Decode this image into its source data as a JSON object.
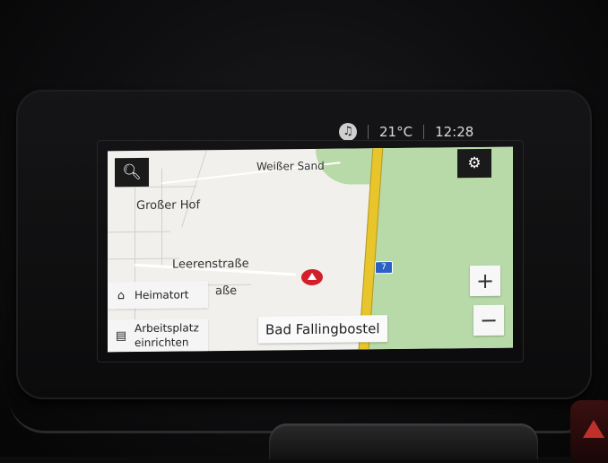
{
  "status_bar": {
    "music_icon": "music-note-icon",
    "temperature": "21°C",
    "clock": "12:28"
  },
  "map": {
    "labels": {
      "weisser_sand": "Weißer Sand",
      "grosser_hof": "Großer Hof",
      "leerenstrasse": "Leerenstraße",
      "partial_street": "aße"
    },
    "highway_number": "7",
    "colors": {
      "land": "#f1f0ec",
      "green_area": "#b8d9a8",
      "highway": "#e8c52b",
      "marker": "#d21f2a",
      "highway_badge": "#2a5fc4"
    }
  },
  "controls": {
    "search_icon": "search-icon",
    "settings_icon": "gear-icon",
    "zoom_in_label": "+",
    "zoom_out_label": "−"
  },
  "favorites": {
    "home": {
      "icon": "home-icon",
      "label": "Heimatort"
    },
    "work": {
      "icon": "briefcase-icon",
      "label_line1": "Arbeitsplatz",
      "label_line2": "einrichten"
    }
  },
  "destination": "Bad Fallingbostel"
}
